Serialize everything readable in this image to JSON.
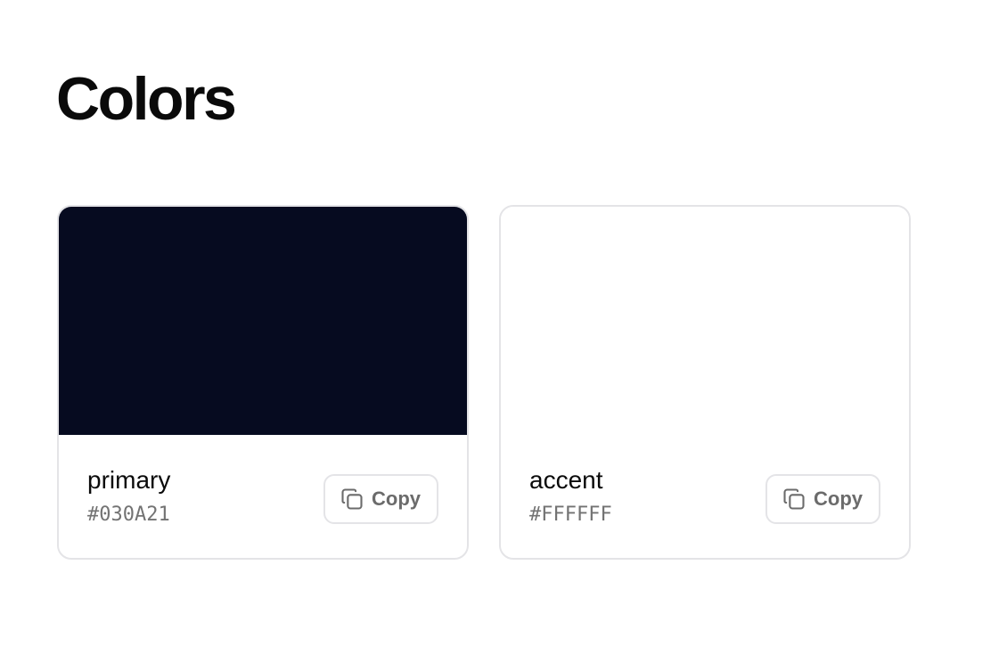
{
  "page": {
    "title": "Colors"
  },
  "colors": [
    {
      "name": "primary",
      "hex": "#030A21",
      "swatch": "#060B20",
      "copy_label": "Copy",
      "icon": "copy-icon"
    },
    {
      "name": "accent",
      "hex": "#FFFFFF",
      "swatch": "#FFFFFF",
      "copy_label": "Copy",
      "icon": "copy-icon"
    }
  ],
  "theme": {
    "border": "#E4E4E7",
    "muted_text": "#737373"
  }
}
